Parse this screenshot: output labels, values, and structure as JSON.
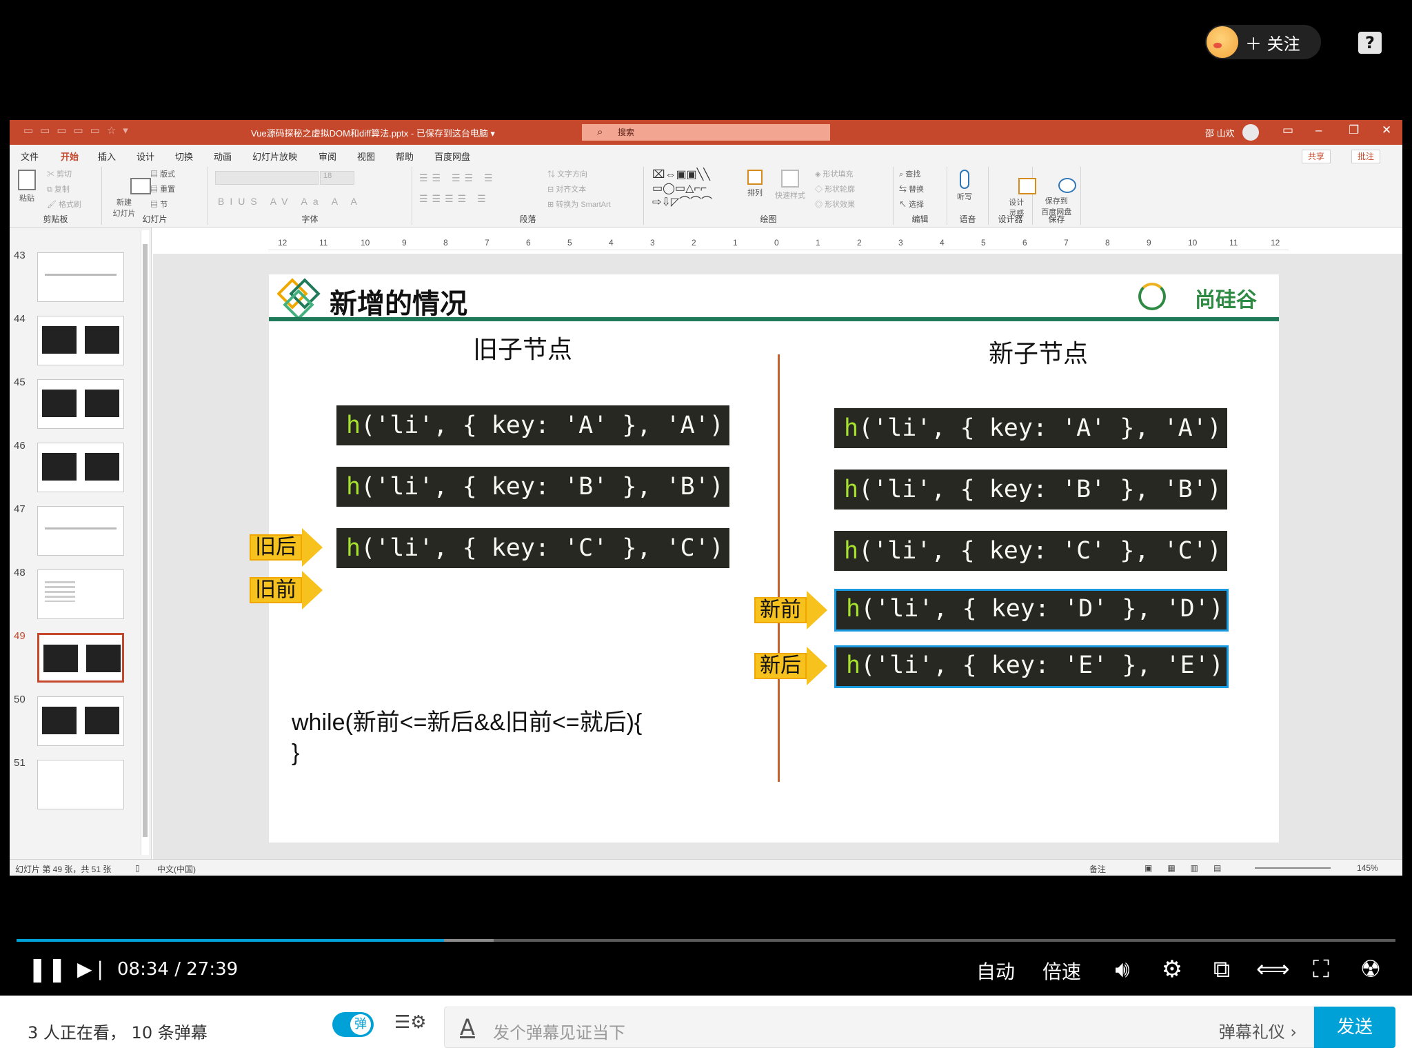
{
  "overlay": {
    "follow_label": "＋ 关注",
    "help_label": "?"
  },
  "ppt": {
    "doc_title": "Vue源码探秘之虚拟DOM和diff算法.pptx - 已保存到这台电脑 ▾",
    "search_placeholder": "搜索",
    "user": "邵 山欢",
    "menu": [
      "文件",
      "开始",
      "插入",
      "设计",
      "切换",
      "动画",
      "幻灯片放映",
      "审阅",
      "视图",
      "帮助",
      "百度网盘"
    ],
    "share_label": "共享",
    "comment_label": "批注",
    "ribbon_groups": {
      "clipboard": "剪贴板",
      "slides": "幻灯片",
      "font": "字体",
      "paragraph": "段落",
      "drawing": "绘图",
      "editing": "编辑",
      "voice": "语音",
      "designer": "设计器",
      "save": "保存"
    },
    "ribbon_buttons": {
      "paste": "粘贴",
      "cut": "剪切",
      "copy": "复制",
      "format_painter": "格式刷",
      "new_slide": "新建\n幻灯片",
      "layout": "版式",
      "reset": "重置",
      "section": "节",
      "font_size": "18",
      "text_direction": "文字方向",
      "align_text": "对齐文本",
      "smartart": "转换为 SmartArt",
      "arrange": "排列",
      "quick_styles": "快速样式",
      "shape_fill": "形状填充",
      "shape_outline": "形状轮廓",
      "shape_effects": "形状效果",
      "find": "查找",
      "replace": "替换",
      "select": "选择",
      "dictate": "听写",
      "design_ideas": "设计\n灵感",
      "save_baidu": "保存到\n百度网盘"
    },
    "ruler_ticks": [
      "12",
      "11",
      "10",
      "9",
      "8",
      "7",
      "6",
      "5",
      "4",
      "3",
      "2",
      "1",
      "0",
      "1",
      "2",
      "3",
      "4",
      "5",
      "6",
      "7",
      "8",
      "9",
      "10",
      "11",
      "12"
    ],
    "thumbnails": [
      {
        "num": "43",
        "kind": "title"
      },
      {
        "num": "44",
        "kind": "code"
      },
      {
        "num": "45",
        "kind": "code"
      },
      {
        "num": "46",
        "kind": "code"
      },
      {
        "num": "47",
        "kind": "title"
      },
      {
        "num": "48",
        "kind": "list"
      },
      {
        "num": "49",
        "kind": "code",
        "selected": true
      },
      {
        "num": "50",
        "kind": "code"
      },
      {
        "num": "51",
        "kind": "blank"
      }
    ],
    "status": {
      "slide_info": "幻灯片 第 49 张，共 51 张",
      "language": "中文(中国)",
      "notes": "备注",
      "zoom": "145%"
    }
  },
  "slide": {
    "title": "新增的情况",
    "brand": "尚硅谷",
    "old_header": "旧子节点",
    "new_header": "新子节点",
    "old_nodes": [
      {
        "prefix": "h",
        "body": "('li', { key: 'A' }, 'A')"
      },
      {
        "prefix": "h",
        "body": "('li', { key: 'B' }, 'B')"
      },
      {
        "prefix": "h",
        "body": "('li', { key: 'C' }, 'C')"
      }
    ],
    "new_nodes": [
      {
        "prefix": "h",
        "body": "('li', { key: 'A' }, 'A')"
      },
      {
        "prefix": "h",
        "body": "('li', { key: 'B' }, 'B')"
      },
      {
        "prefix": "h",
        "body": "('li', { key: 'C' }, 'C')"
      },
      {
        "prefix": "h",
        "body": "('li', { key: 'D' }, 'D')"
      },
      {
        "prefix": "h",
        "body": "('li', { key: 'E' }, 'E')"
      }
    ],
    "pointers": {
      "old_end": "旧后",
      "old_start": "旧前",
      "new_start": "新前",
      "new_end": "新后"
    },
    "code_line1": "while(新前<=新后&&旧前<=就后){",
    "code_line2": "}"
  },
  "player": {
    "current_time": "08:34",
    "separator": "/",
    "duration": "27:39",
    "progress_fraction": 0.31,
    "quality": "自动",
    "speed": "倍速",
    "accent": "#00a1d6"
  },
  "danmaku": {
    "viewers": "3 人正在看，",
    "count": "10 条弹幕",
    "toggle_label": "弹",
    "placeholder": "发个弹幕见证当下",
    "etiquette": "弹幕礼仪 ›",
    "send": "发送"
  }
}
